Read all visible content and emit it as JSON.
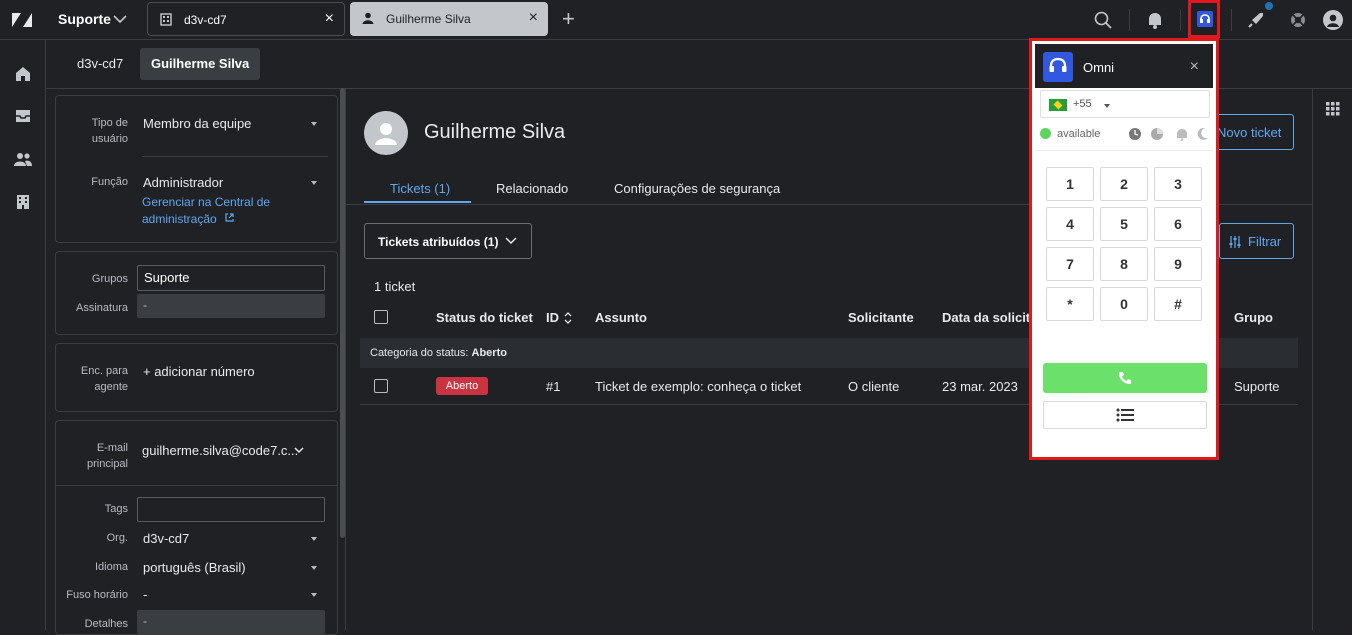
{
  "topbar": {
    "workspace": "Suporte",
    "tabs": [
      {
        "label": "d3v-cd7",
        "icon": "building-icon"
      },
      {
        "label": "Guilherme Silva",
        "icon": "user-icon"
      }
    ],
    "close_glyph": "×",
    "add_glyph": "+"
  },
  "subtabs": [
    "d3v-cd7",
    "Guilherme Silva"
  ],
  "left_panel": {
    "tipo_label": "Tipo de usuário",
    "tipo_value": "Membro da equipe",
    "funcao_label": "Função",
    "funcao_value": "Administrador",
    "admin_link": "Gerenciar na Central de administração",
    "grupos_label": "Grupos",
    "grupos_value": "Suporte",
    "assinatura_label": "Assinatura",
    "assinatura_value": "-",
    "enc_label": "Enc. para agente",
    "enc_value": "+ adicionar número",
    "email_label": "E-mail principal",
    "email_value": "guilherme.silva@code7.c...",
    "tags_label": "Tags",
    "org_label": "Org.",
    "org_value": "d3v-cd7",
    "idioma_label": "Idioma",
    "idioma_value": "português (Brasil)",
    "fuso_label": "Fuso horário",
    "fuso_value": "-",
    "detalhes_label": "Detalhes",
    "detalhes_value": "-"
  },
  "main": {
    "user_name": "Guilherme Silva",
    "new_ticket": "Novo ticket",
    "tabs": [
      "Tickets (1)",
      "Relacionado",
      "Configurações de segurança"
    ],
    "view_dropdown": "Tickets atribuídos (1)",
    "filter": "Filtrar",
    "count": "1 ticket",
    "columns": [
      "Status do ticket",
      "ID",
      "Assunto",
      "Solicitante",
      "Data da solicita",
      "Grupo"
    ],
    "category_row_prefix": "Categoria do status:",
    "category_row_value": "Aberto",
    "row": {
      "status": "Aberto",
      "id": "#1",
      "subject": "Ticket de exemplo: conheça o ticket",
      "requester": "O cliente",
      "date": "23 mar. 2023",
      "group": "Suporte"
    }
  },
  "omni": {
    "title": "Omni",
    "country_code": "+55",
    "status": "available",
    "keys": [
      "1",
      "2",
      "3",
      "4",
      "5",
      "6",
      "7",
      "8",
      "9",
      "*",
      "0",
      "#"
    ]
  },
  "colors": {
    "accent": "#5fa8f0",
    "highlight": "#e0191e",
    "badge": "#cc3340",
    "call": "#6be06b",
    "omni_brand": "#3358e0"
  }
}
